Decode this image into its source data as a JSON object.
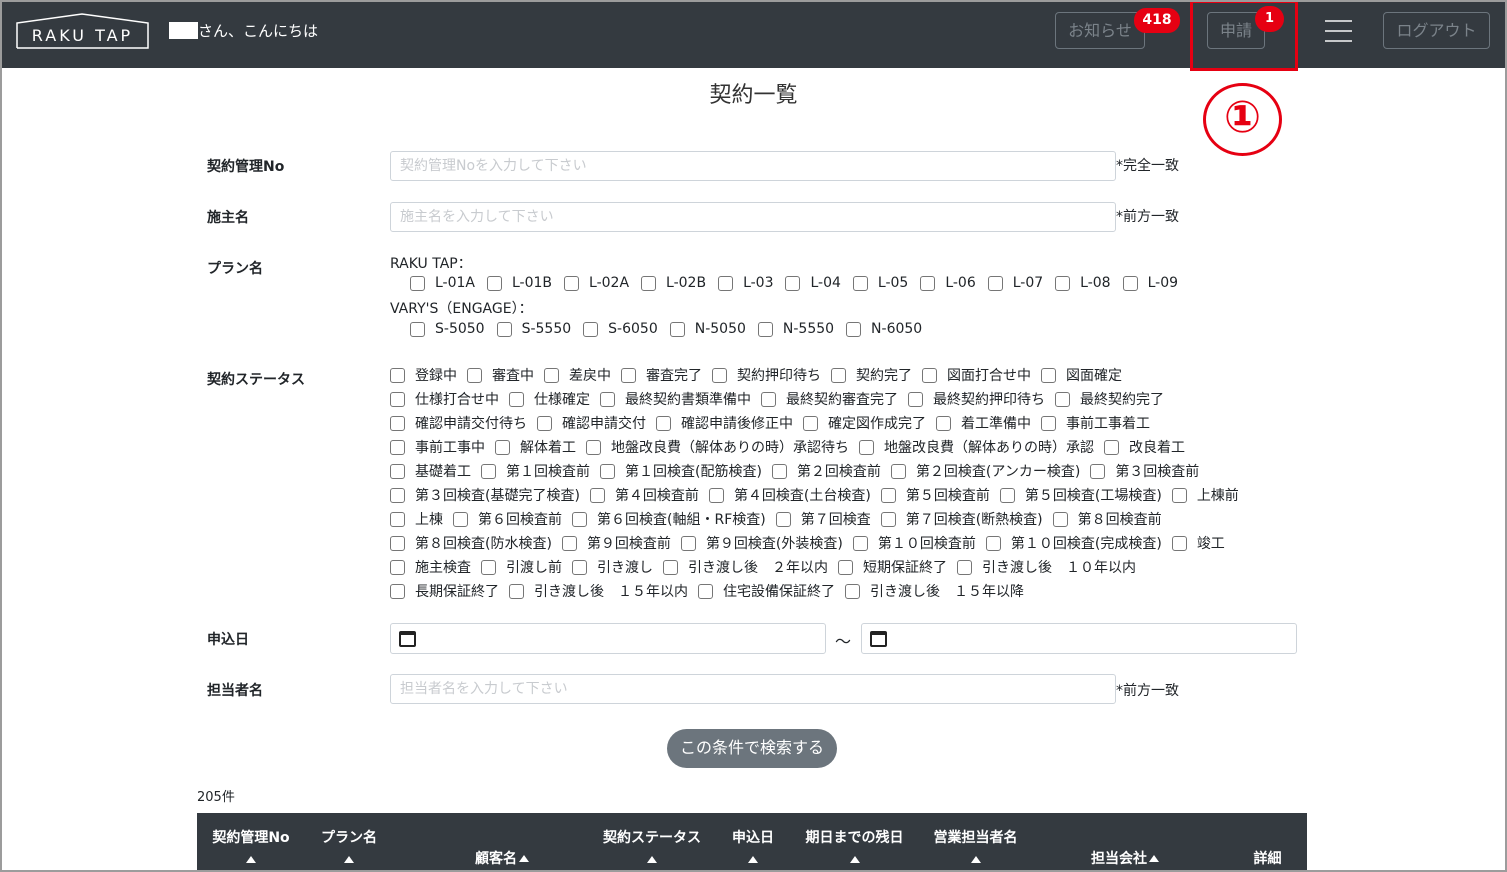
{
  "header": {
    "logo_text": "RAKU TAP",
    "greeting_suffix": "さん、こんにちは",
    "news_label": "お知らせ",
    "news_badge": "418",
    "apply_label": "申請",
    "apply_badge": "1",
    "logout_label": "ログアウト"
  },
  "annotation": {
    "marker": "①",
    "color": "#e60012"
  },
  "page": {
    "title": "契約一覧"
  },
  "form": {
    "contract_no": {
      "label": "契約管理No",
      "placeholder": "契約管理Noを入力して下さい",
      "suffix": "*完全一致"
    },
    "owner": {
      "label": "施主名",
      "placeholder": "施主名を入力して下さい",
      "suffix": "*前方一致"
    },
    "plan": {
      "label": "プラン名",
      "group1": {
        "title": "RAKU TAP：",
        "options": [
          "L-01A",
          "L-01B",
          "L-02A",
          "L-02B",
          "L-03",
          "L-04",
          "L-05",
          "L-06",
          "L-07",
          "L-08",
          "L-09"
        ]
      },
      "group2": {
        "title": "VARY'S（ENGAGE）：",
        "options": [
          "S-5050",
          "S-5550",
          "S-6050",
          "N-5050",
          "N-5550",
          "N-6050"
        ]
      }
    },
    "status": {
      "label": "契約ステータス",
      "rows": [
        [
          "登録中",
          "審査中",
          "差戻中",
          "審査完了",
          "契約押印待ち",
          "契約完了",
          "図面打合せ中",
          "図面確定"
        ],
        [
          "仕様打合せ中",
          "仕様確定",
          "最終契約書類準備中",
          "最終契約審査完了",
          "最終契約押印待ち",
          "最終契約完了"
        ],
        [
          "確認申請交付待ち",
          "確認申請交付",
          "確認申請後修正中",
          "確定図作成完了",
          "着工準備中",
          "事前工事着工"
        ],
        [
          "事前工事中",
          "解体着工",
          "地盤改良費（解体ありの時）承認待ち",
          "地盤改良費（解体ありの時）承認",
          "改良着工"
        ],
        [
          "基礎着工",
          "第１回検査前",
          "第１回検査(配筋検査)",
          "第２回検査前",
          "第２回検査(アンカー検査)",
          "第３回検査前"
        ],
        [
          "第３回検査(基礎完了検査)",
          "第４回検査前",
          "第４回検査(土台検査)",
          "第５回検査前",
          "第５回検査(工場検査)",
          "上棟前"
        ],
        [
          "上棟",
          "第６回検査前",
          "第６回検査(軸組・RF検査)",
          "第７回検査",
          "第７回検査(断熱検査)",
          "第８回検査前"
        ],
        [
          "第８回検査(防水検査)",
          "第９回検査前",
          "第９回検査(外装検査)",
          "第１０回検査前",
          "第１０回検査(完成検査)",
          "竣工"
        ],
        [
          "施主検査",
          "引渡し前",
          "引き渡し",
          "引き渡し後　２年以内",
          "短期保証終了",
          "引き渡し後　１０年以内"
        ],
        [
          "長期保証終了",
          "引き渡し後　１５年以内",
          "住宅設備保証終了",
          "引き渡し後　１５年以降"
        ]
      ]
    },
    "apply_date": {
      "label": "申込日",
      "separator": "～"
    },
    "staff": {
      "label": "担当者名",
      "placeholder": "担当者名を入力して下さい",
      "suffix": "*前方一致"
    },
    "search_button": "この条件で検索する"
  },
  "results": {
    "count": "205件",
    "columns": [
      "契約管理No",
      "プラン名",
      "顧客名",
      "契約ステータス",
      "申込日",
      "期日までの残日",
      "営業担当者名",
      "担当会社",
      "詳細"
    ]
  }
}
